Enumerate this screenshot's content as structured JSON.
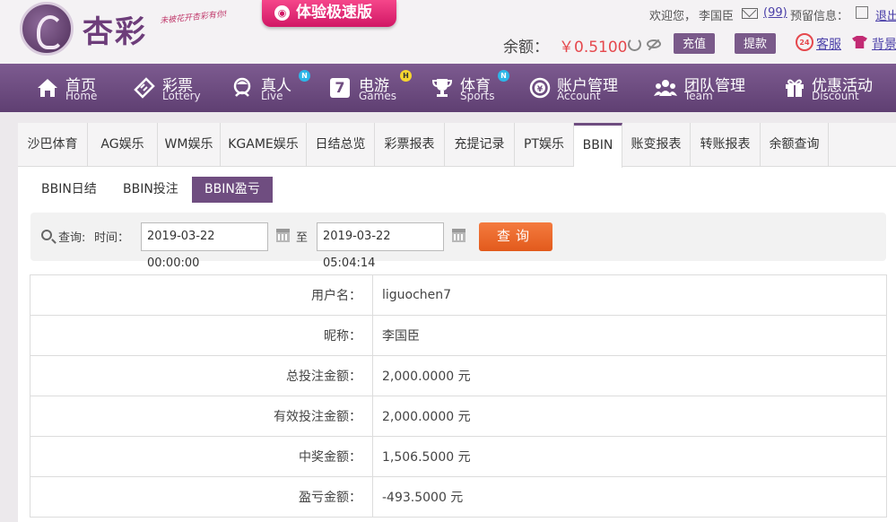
{
  "brand": {
    "logo_text": "杏彩",
    "slogan": "未被花开杏彩有你!",
    "promo_label": "体验极速版"
  },
  "header": {
    "welcome": "欢迎您，",
    "username": "李国臣",
    "mail_count": "(99)",
    "warning_label": "预留信息：",
    "logout": "退出",
    "balance_label": "余额：",
    "balance_value": "￥0.5100",
    "deposit_button": "充值",
    "withdraw_button": "提款",
    "cs_icon_text": "24",
    "customer_service": "客服",
    "skin": "背景"
  },
  "nav": {
    "items": [
      {
        "zh": "首页",
        "en": "Home",
        "icon": "home-icon"
      },
      {
        "zh": "彩票",
        "en": "Lottery",
        "icon": "ticket-icon"
      },
      {
        "zh": "真人",
        "en": "Live",
        "icon": "lady-icon",
        "badge": "N"
      },
      {
        "zh": "电游",
        "en": "Games",
        "icon": "seven-icon",
        "badge": "H"
      },
      {
        "zh": "体育",
        "en": "Sports",
        "icon": "trophy-icon",
        "badge": "N"
      },
      {
        "zh": "账户管理",
        "en": "Account",
        "icon": "coin-icon"
      },
      {
        "zh": "团队管理",
        "en": "Team",
        "icon": "team-icon"
      },
      {
        "zh": "优惠活动",
        "en": "Discount",
        "icon": "gift-icon"
      }
    ],
    "seven_glyph": "7"
  },
  "tabs": [
    "沙巴体育",
    "AG娱乐",
    "WM娱乐",
    "KGAME娱乐",
    "日结总览",
    "彩票报表",
    "充提记录",
    "PT娱乐",
    "BBIN",
    "账变报表",
    "转账报表",
    "余额查询"
  ],
  "active_tab": "BBIN",
  "subtabs": [
    "BBIN日结",
    "BBIN投注",
    "BBIN盈亏"
  ],
  "active_subtab": "BBIN盈亏",
  "query": {
    "query_label": "查询:",
    "time_label": "时间：",
    "start_time": "2019-03-22 00:00:00",
    "to_label": "至",
    "end_time": "2019-03-22 05:04:14",
    "search_button": "查询"
  },
  "report": {
    "rows": [
      {
        "label": "用户名：",
        "value": "liguochen7"
      },
      {
        "label": "昵称：",
        "value": "李国臣"
      },
      {
        "label": "总投注金额：",
        "value": "2,000.0000 元"
      },
      {
        "label": "有效投注金额：",
        "value": "2,000.0000 元"
      },
      {
        "label": "中奖金额：",
        "value": "1,506.5000 元"
      },
      {
        "label": "盈亏金额：",
        "value": "-493.5000 元"
      }
    ]
  },
  "colors": {
    "nav_bg": "#6f4d80",
    "accent_orange": "#e8642a",
    "balance_red": "#e5484d",
    "promo_pink": "#e0297a"
  }
}
